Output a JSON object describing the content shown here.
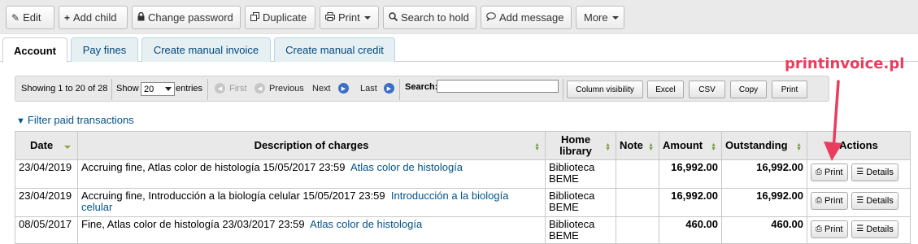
{
  "toolbar": {
    "edit": "Edit",
    "add_child": "Add child",
    "change_password": "Change password",
    "duplicate": "Duplicate",
    "print": "Print",
    "search_to_hold": "Search to hold",
    "add_message": "Add message",
    "more": "More"
  },
  "tabs": [
    {
      "label": "Account",
      "active": true
    },
    {
      "label": "Pay fines"
    },
    {
      "label": "Create manual invoice"
    },
    {
      "label": "Create manual credit"
    }
  ],
  "datatable": {
    "info": "Showing 1 to 20 of 28",
    "show_label": "Show",
    "show_value": "20",
    "entries_label": "entries",
    "first": "First",
    "previous": "Previous",
    "next": "Next",
    "last": "Last",
    "search_label": "Search:",
    "search_value": "",
    "buttons": {
      "column_visibility": "Column visibility",
      "excel": "Excel",
      "csv": "CSV",
      "copy": "Copy",
      "print": "Print"
    }
  },
  "filter_link": "Filter paid transactions",
  "table": {
    "headers": {
      "date": "Date",
      "description": "Description of charges",
      "home_library": "Home library",
      "note": "Note",
      "amount": "Amount",
      "outstanding": "Outstanding",
      "actions": "Actions"
    },
    "rows": [
      {
        "date": "23/04/2019",
        "description": "Accruing fine, Atlas color de histología 15/05/2017 23:59",
        "link": "Atlas color de histología",
        "library": "Biblioteca BEME",
        "note": "",
        "amount": "16,992.00",
        "outstanding": "16,992.00",
        "print": "Print",
        "details": "Details"
      },
      {
        "date": "23/04/2019",
        "description": "Accruing fine, Introducción a la biología celular 15/05/2017 23:59",
        "link": "Introducción a la biología celular",
        "library": "Biblioteca BEME",
        "note": "",
        "amount": "16,992.00",
        "outstanding": "16,992.00",
        "print": "Print",
        "details": "Details"
      },
      {
        "date": "08/05/2017",
        "description": "Fine, Atlas color de histología 23/03/2017 23:59",
        "link": "Atlas color de histología",
        "library": "Biblioteca BEME",
        "note": "",
        "amount": "460.00",
        "outstanding": "460.00",
        "print": "Print",
        "details": "Details"
      }
    ]
  },
  "annotation": {
    "label": "printinvoice.pl",
    "color": "#ea3d5e"
  },
  "colors": {
    "link": "#00538a",
    "money": "#cc0000",
    "tab_bg": "#e6f0f2"
  }
}
